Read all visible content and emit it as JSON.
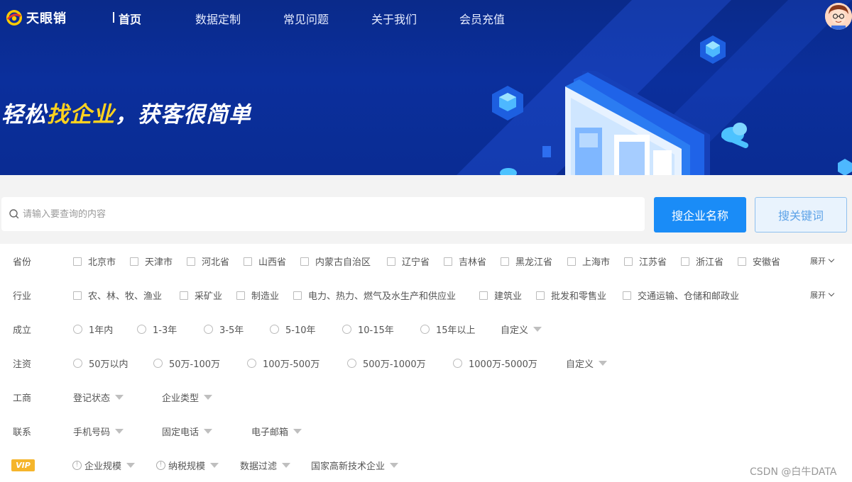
{
  "header": {
    "logo_text": "天眼销",
    "nav": [
      "首页",
      "数据定制",
      "常见问题",
      "关于我们",
      "会员充值"
    ]
  },
  "hero": {
    "slogan_part1": "轻松",
    "slogan_highlight": "找企业",
    "slogan_part2": "，获客很简单"
  },
  "search": {
    "placeholder": "请输入要查询的内容",
    "btn_company": "搜企业名称",
    "btn_keyword": "搜关键词"
  },
  "filters": {
    "expand_label": "展开",
    "province": {
      "label": "省份",
      "options": [
        "北京市",
        "天津市",
        "河北省",
        "山西省",
        "内蒙古自治区",
        "辽宁省",
        "吉林省",
        "黑龙江省",
        "上海市",
        "江苏省",
        "浙江省",
        "安徽省"
      ]
    },
    "industry": {
      "label": "行业",
      "options": [
        "农、林、牧、渔业",
        "采矿业",
        "制造业",
        "电力、热力、燃气及水生产和供应业",
        "建筑业",
        "批发和零售业",
        "交通运输、仓储和邮政业"
      ]
    },
    "founded": {
      "label": "成立",
      "options": [
        "1年内",
        "1-3年",
        "3-5年",
        "5-10年",
        "10-15年",
        "15年以上"
      ],
      "custom": "自定义"
    },
    "capital": {
      "label": "注资",
      "options": [
        "50万以内",
        "50万-100万",
        "100万-500万",
        "500万-1000万",
        "1000万-5000万"
      ],
      "custom": "自定义"
    },
    "business": {
      "label": "工商",
      "dropdowns": [
        "登记状态",
        "企业类型"
      ]
    },
    "contact": {
      "label": "联系",
      "dropdowns": [
        "手机号码",
        "固定电话",
        "电子邮箱"
      ]
    },
    "vip": {
      "badge": "VIP",
      "dropdowns": [
        "企业规模",
        "纳税规模",
        "数据过滤",
        "国家高新技术企业"
      ]
    }
  },
  "watermark": "CSDN @白牛DATA",
  "colors": {
    "hero_bg": "#0b2f9c",
    "highlight": "#ffd21f",
    "primary_button": "#1a8cf7",
    "vip_badge": "#f5b52b"
  }
}
